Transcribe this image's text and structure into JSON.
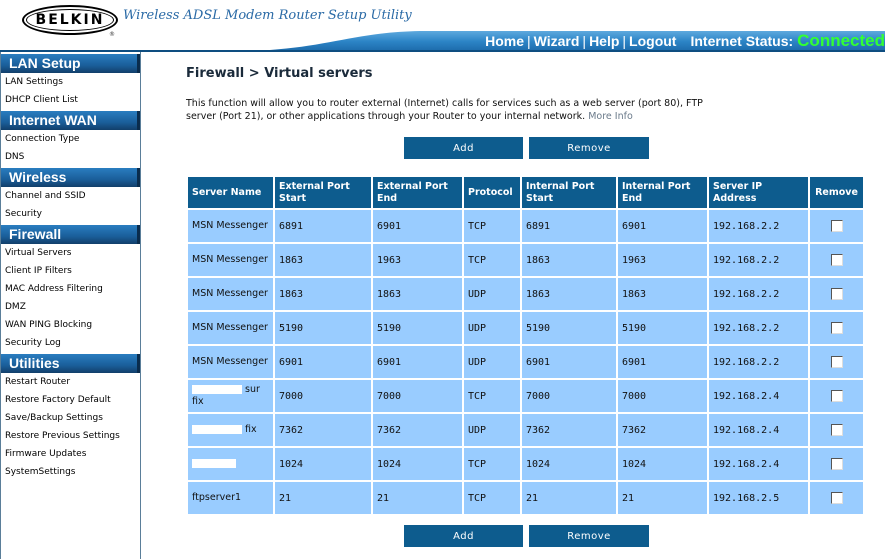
{
  "header": {
    "brand": "BELKIN",
    "app_title": "Wireless ADSL Modem Router Setup Utility",
    "nav": [
      "Home",
      "Wizard",
      "Help",
      "Logout"
    ],
    "status_label": "Internet Status:",
    "status_value": "Connected",
    "status_color": "#33ff33"
  },
  "sidebar": {
    "sections": [
      {
        "title": "LAN Setup",
        "items": [
          "LAN Settings",
          "DHCP Client List"
        ]
      },
      {
        "title": "Internet WAN",
        "items": [
          "Connection Type",
          "DNS"
        ]
      },
      {
        "title": "Wireless",
        "items": [
          "Channel and SSID",
          "Security"
        ]
      },
      {
        "title": "Firewall",
        "items": [
          "Virtual Servers",
          "Client IP Filters",
          "MAC Address Filtering",
          "DMZ",
          "WAN PING Blocking",
          "Security Log"
        ]
      },
      {
        "title": "Utilities",
        "items": [
          "Restart Router",
          "Restore Factory Default",
          "Save/Backup Settings",
          "Restore Previous Settings",
          "Firmware Updates",
          "SystemSettings"
        ]
      }
    ]
  },
  "main": {
    "title": "Firewall > Virtual servers",
    "description": "This function will allow you to router external (Internet) calls for services such as a web server (port 80), FTP server (Port 21), or other applications through your Router to your internal network.",
    "more_info": "More Info",
    "add_label": "Add",
    "remove_label": "Remove",
    "table": {
      "headers": [
        "Server Name",
        "External Port Start",
        "External Port End",
        "Protocol",
        "Internal Port Start",
        "Internal Port End",
        "Server IP Address",
        "Remove"
      ],
      "rows": [
        {
          "name": "MSN Messenger",
          "ext_start": "6891",
          "ext_end": "6901",
          "protocol": "TCP",
          "int_start": "6891",
          "int_end": "6901",
          "ip": "192.168.2.2"
        },
        {
          "name": "MSN Messenger",
          "ext_start": "1863",
          "ext_end": "1963",
          "protocol": "TCP",
          "int_start": "1863",
          "int_end": "1963",
          "ip": "192.168.2.2"
        },
        {
          "name": "MSN Messenger",
          "ext_start": "1863",
          "ext_end": "1863",
          "protocol": "UDP",
          "int_start": "1863",
          "int_end": "1863",
          "ip": "192.168.2.2"
        },
        {
          "name": "MSN Messenger",
          "ext_start": "5190",
          "ext_end": "5190",
          "protocol": "UDP",
          "int_start": "5190",
          "int_end": "5190",
          "ip": "192.168.2.2"
        },
        {
          "name": "MSN Messenger",
          "ext_start": "6901",
          "ext_end": "6901",
          "protocol": "UDP",
          "int_start": "6901",
          "int_end": "6901",
          "ip": "192.168.2.2"
        },
        {
          "name": "[redacted] sur fix",
          "ext_start": "7000",
          "ext_end": "7000",
          "protocol": "TCP",
          "int_start": "7000",
          "int_end": "7000",
          "ip": "192.168.2.4"
        },
        {
          "name": "[redacted] fix",
          "ext_start": "7362",
          "ext_end": "7362",
          "protocol": "UDP",
          "int_start": "7362",
          "int_end": "7362",
          "ip": "192.168.2.4"
        },
        {
          "name": "[redacted]",
          "ext_start": "1024",
          "ext_end": "1024",
          "protocol": "TCP",
          "int_start": "1024",
          "int_end": "1024",
          "ip": "192.168.2.4"
        },
        {
          "name": "ftpserver1",
          "ext_start": "21",
          "ext_end": "21",
          "protocol": "TCP",
          "int_start": "21",
          "int_end": "21",
          "ip": "192.168.2.5"
        }
      ]
    }
  }
}
